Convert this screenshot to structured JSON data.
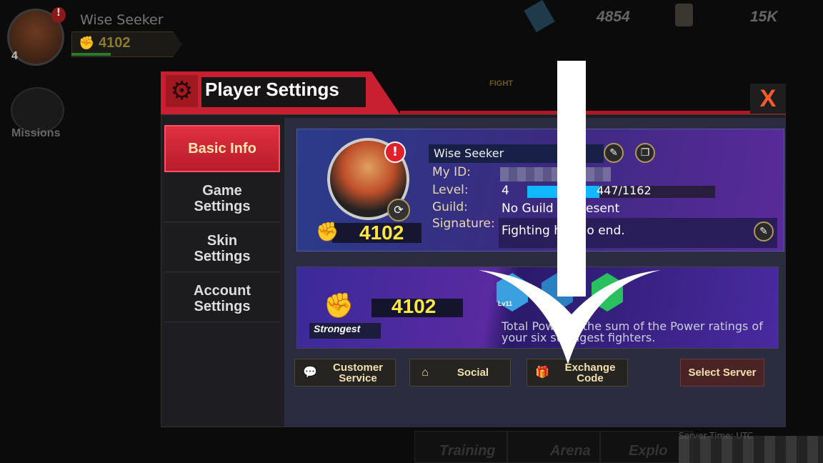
{
  "hud": {
    "player_name": "Wise Seeker",
    "power": "4102",
    "level": "4",
    "alert": "!",
    "missions_label": "Missions",
    "currencies": [
      "4854",
      "15K"
    ],
    "fight_label": "FIGHT"
  },
  "dialog": {
    "title": "Player Settings",
    "close_label": "X",
    "sidebar": [
      {
        "label": "Basic Info",
        "active": true
      },
      {
        "label": "Game Settings"
      },
      {
        "label": "Skin Settings"
      },
      {
        "label": "Account Settings"
      }
    ],
    "profile": {
      "name": "Wise Seeker",
      "alert": "!",
      "power": "4102",
      "labels": {
        "id": "My ID:",
        "level": "Level:",
        "guild": "Guild:",
        "signature": "Signature:"
      },
      "level": "4",
      "xp": "447/1162",
      "xp_fraction": 0.385,
      "guild": "No Guild at present",
      "signature": "Fighting has no end."
    },
    "strongest": {
      "label": "Strongest",
      "power": "4102",
      "fighter_level": "Lv11",
      "description": "Total Power is the sum of the Power ratings of your six strongest fighters."
    },
    "buttons": {
      "customer_service": "Customer Service",
      "social": "Social",
      "exchange_code": "Exchange Code",
      "select_server": "Select Server"
    }
  },
  "bottom_nav": [
    "Training",
    "Arena",
    "Explo"
  ],
  "server_time": "Server Time: UTC"
}
